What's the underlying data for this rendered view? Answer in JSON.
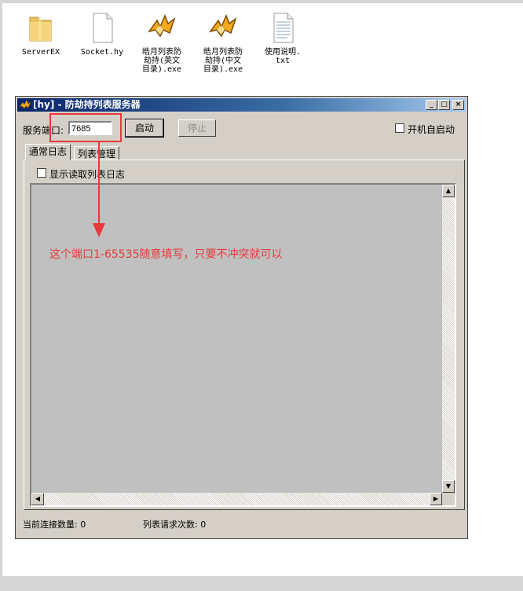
{
  "desktop_icons": [
    {
      "name": "folder-icon",
      "label": "ServerEX"
    },
    {
      "name": "blank-file-icon",
      "label": "Socket.hy"
    },
    {
      "name": "app-exe-icon",
      "label": "皓月列表防\n劫持(英文\n目录).exe"
    },
    {
      "name": "app-exe-icon",
      "label": "皓月列表防\n劫持(中文\n目录).exe"
    },
    {
      "name": "text-file-icon",
      "label": "使用说明.\ntxt"
    }
  ],
  "window": {
    "title": "[hy] - 防劫持列表服务器",
    "port_label": "服务端口:",
    "port_value": "7685",
    "start_button": "启动",
    "stop_button": "停止",
    "autostart_label": "开机自启动",
    "tabs": [
      {
        "label": "通常日志",
        "active": true
      },
      {
        "label": "列表管理",
        "active": false
      }
    ],
    "show_read_log_label": "显示读取列表日志",
    "status": {
      "connections": "当前连接数量: 0",
      "requests": "列表请求次数: 0"
    }
  },
  "annotation": {
    "text": "这个端口1-65535随意填写，只要不冲突就可以",
    "color": "#e8393b"
  },
  "colors": {
    "title_bar_start": "#0a246a",
    "title_bar_end": "#a6caf0",
    "window_bg": "#d4d0c8",
    "log_bg": "#c0c0c0"
  }
}
